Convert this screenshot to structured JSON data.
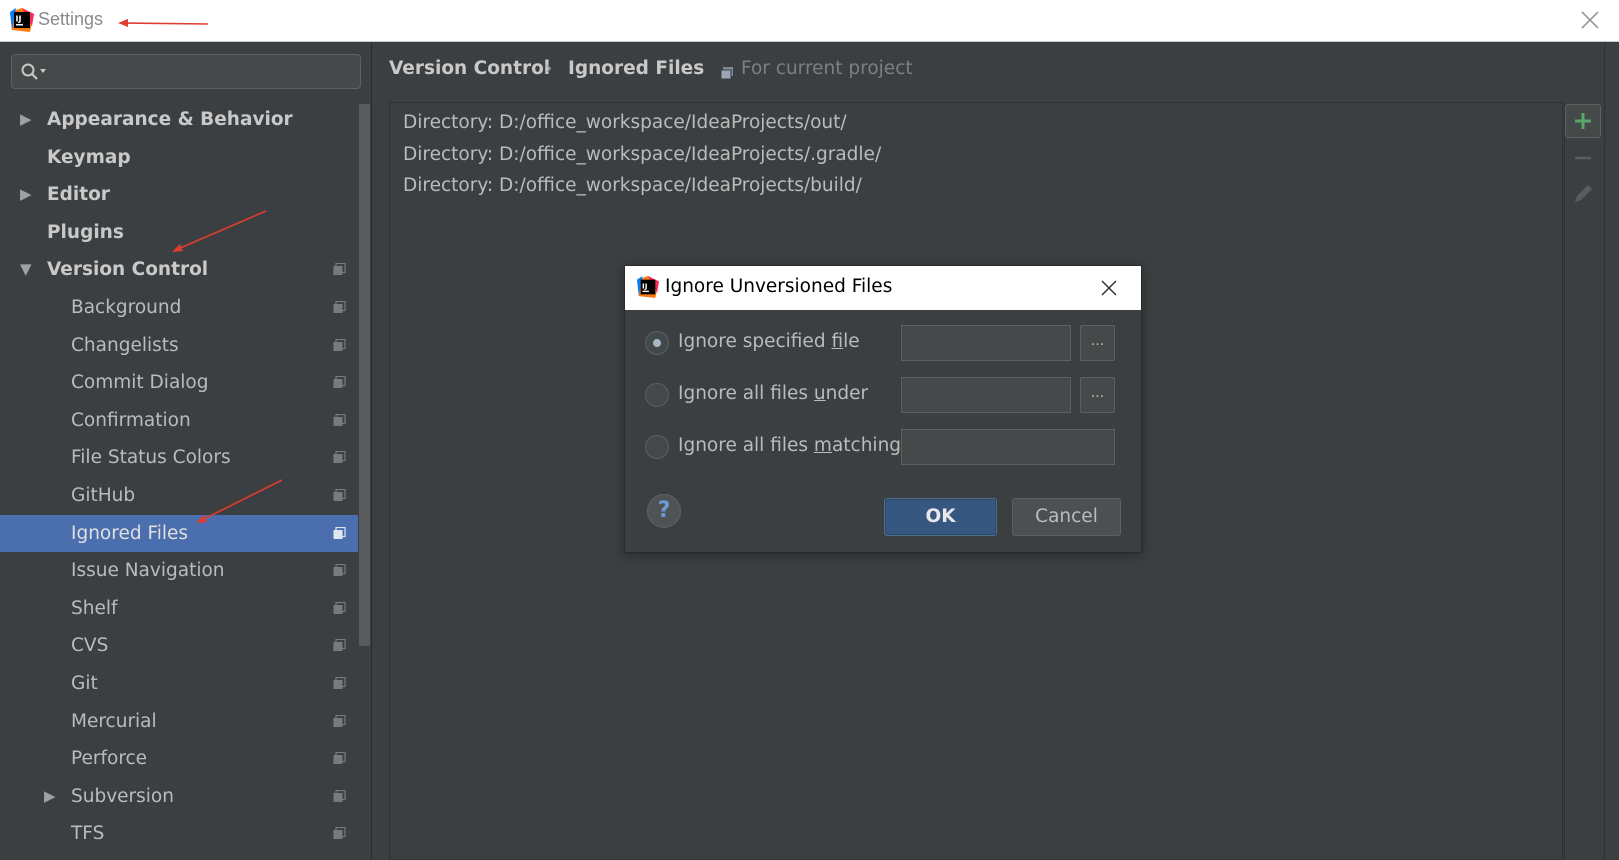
{
  "window": {
    "title": "Settings"
  },
  "search": {
    "placeholder": ""
  },
  "sidebar": {
    "items": [
      {
        "label": "Appearance & Behavior",
        "level": 0,
        "bold": true,
        "arrow": "right",
        "project_icon": false,
        "selected": false
      },
      {
        "label": "Keymap",
        "level": 0,
        "bold": true,
        "arrow": "",
        "project_icon": false,
        "selected": false
      },
      {
        "label": "Editor",
        "level": 0,
        "bold": true,
        "arrow": "right",
        "project_icon": false,
        "selected": false
      },
      {
        "label": "Plugins",
        "level": 0,
        "bold": true,
        "arrow": "",
        "project_icon": false,
        "selected": false
      },
      {
        "label": "Version Control",
        "level": 0,
        "bold": true,
        "arrow": "down",
        "project_icon": true,
        "selected": false
      },
      {
        "label": "Background",
        "level": 1,
        "bold": false,
        "arrow": "",
        "project_icon": true,
        "selected": false
      },
      {
        "label": "Changelists",
        "level": 1,
        "bold": false,
        "arrow": "",
        "project_icon": true,
        "selected": false
      },
      {
        "label": "Commit Dialog",
        "level": 1,
        "bold": false,
        "arrow": "",
        "project_icon": true,
        "selected": false
      },
      {
        "label": "Confirmation",
        "level": 1,
        "bold": false,
        "arrow": "",
        "project_icon": true,
        "selected": false
      },
      {
        "label": "File Status Colors",
        "level": 1,
        "bold": false,
        "arrow": "",
        "project_icon": true,
        "selected": false
      },
      {
        "label": "GitHub",
        "level": 1,
        "bold": false,
        "arrow": "",
        "project_icon": true,
        "selected": false
      },
      {
        "label": "Ignored Files",
        "level": 1,
        "bold": false,
        "arrow": "",
        "project_icon": true,
        "selected": true
      },
      {
        "label": "Issue Navigation",
        "level": 1,
        "bold": false,
        "arrow": "",
        "project_icon": true,
        "selected": false
      },
      {
        "label": "Shelf",
        "level": 1,
        "bold": false,
        "arrow": "",
        "project_icon": true,
        "selected": false
      },
      {
        "label": "CVS",
        "level": 1,
        "bold": false,
        "arrow": "",
        "project_icon": true,
        "selected": false
      },
      {
        "label": "Git",
        "level": 1,
        "bold": false,
        "arrow": "",
        "project_icon": true,
        "selected": false
      },
      {
        "label": "Mercurial",
        "level": 1,
        "bold": false,
        "arrow": "",
        "project_icon": true,
        "selected": false
      },
      {
        "label": "Perforce",
        "level": 1,
        "bold": false,
        "arrow": "",
        "project_icon": true,
        "selected": false
      },
      {
        "label": "Subversion",
        "level": 1,
        "bold": false,
        "arrow": "right",
        "project_icon": true,
        "selected": false
      },
      {
        "label": "TFS",
        "level": 1,
        "bold": false,
        "arrow": "",
        "project_icon": true,
        "selected": false
      }
    ]
  },
  "breadcrumb": {
    "parent": "Version Control",
    "separator": "›",
    "current": "Ignored Files",
    "scope": "For current project"
  },
  "ignored_list": [
    "Directory: D:/office_workspace/IdeaProjects/out/",
    "Directory: D:/office_workspace/IdeaProjects/.gradle/",
    "Directory: D:/office_workspace/IdeaProjects/build/"
  ],
  "toolbar": {
    "add_icon": "plus-icon",
    "remove_icon": "minus-icon",
    "edit_icon": "pencil-icon"
  },
  "dialog": {
    "title": "Ignore Unversioned Files",
    "options": [
      {
        "pre": "Ignore specified ",
        "u": "f",
        "post": "ile",
        "checked": true,
        "value": "",
        "has_browse": true
      },
      {
        "pre": "Ignore all files ",
        "u": "u",
        "post": "nder",
        "checked": false,
        "value": "",
        "has_browse": true
      },
      {
        "pre": "Ignore all files ",
        "u": "m",
        "post": "atching",
        "checked": false,
        "value": "",
        "has_browse": false
      }
    ],
    "browse_label": "...",
    "help_label": "?",
    "ok_label": "OK",
    "cancel_label": "Cancel"
  },
  "colors": {
    "background": "#3c3f41",
    "selection": "#4b6eaf",
    "ok_button": "#365880",
    "add_icon_green": "#59a869",
    "annotation_arrow": "#e03c31"
  }
}
